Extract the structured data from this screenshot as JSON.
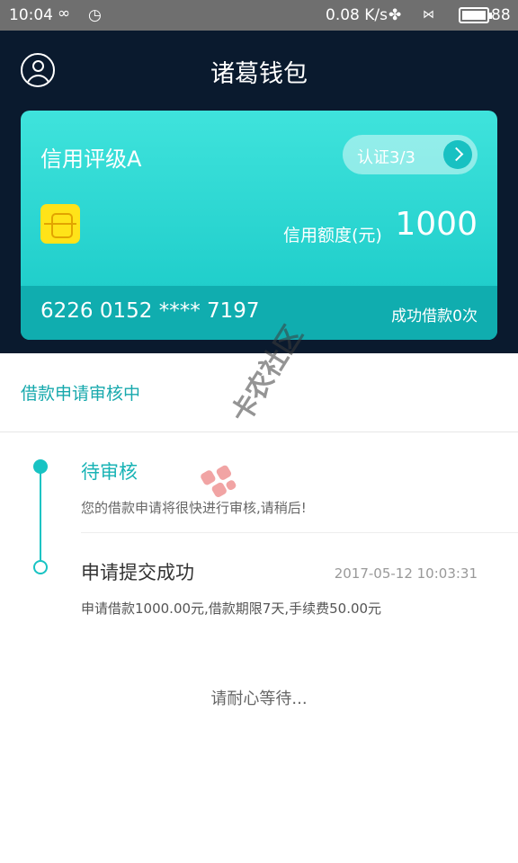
{
  "status_bar": {
    "time": "10:04",
    "speed": "0.08 K/s",
    "battery": "88",
    "icons": [
      "infinity-icon",
      "alarm-icon",
      "fan-icon",
      "signal-icon",
      "battery-icon"
    ]
  },
  "header": {
    "title": "诸葛钱包"
  },
  "card": {
    "credit_rating": "信用评级A",
    "verify_label": "认证3/3",
    "limit_label": "信用额度(元)",
    "limit_value": "1000",
    "card_number": "6226 0152 **** 7197",
    "borrow_count": "成功借款0次",
    "colors": {
      "card_top": "#3fe3dc",
      "card_bottom": "#10adaf",
      "chip": "#ffe319"
    }
  },
  "application": {
    "status_title": "借款申请审核中",
    "steps": [
      {
        "title": "待审核",
        "desc": "您的借款申请将很快进行审核,请稍后!",
        "state": "active"
      },
      {
        "title": "申请提交成功",
        "time": "2017-05-12 10:03:31",
        "desc": "申请借款1000.00元,借款期限7天,手续费50.00元",
        "state": "done"
      }
    ],
    "wait_text": "请耐心等待..."
  },
  "watermark": {
    "text": "卡农社区"
  },
  "theme": {
    "accent": "#18c3c3",
    "header_bg": "#0a1a2e"
  }
}
